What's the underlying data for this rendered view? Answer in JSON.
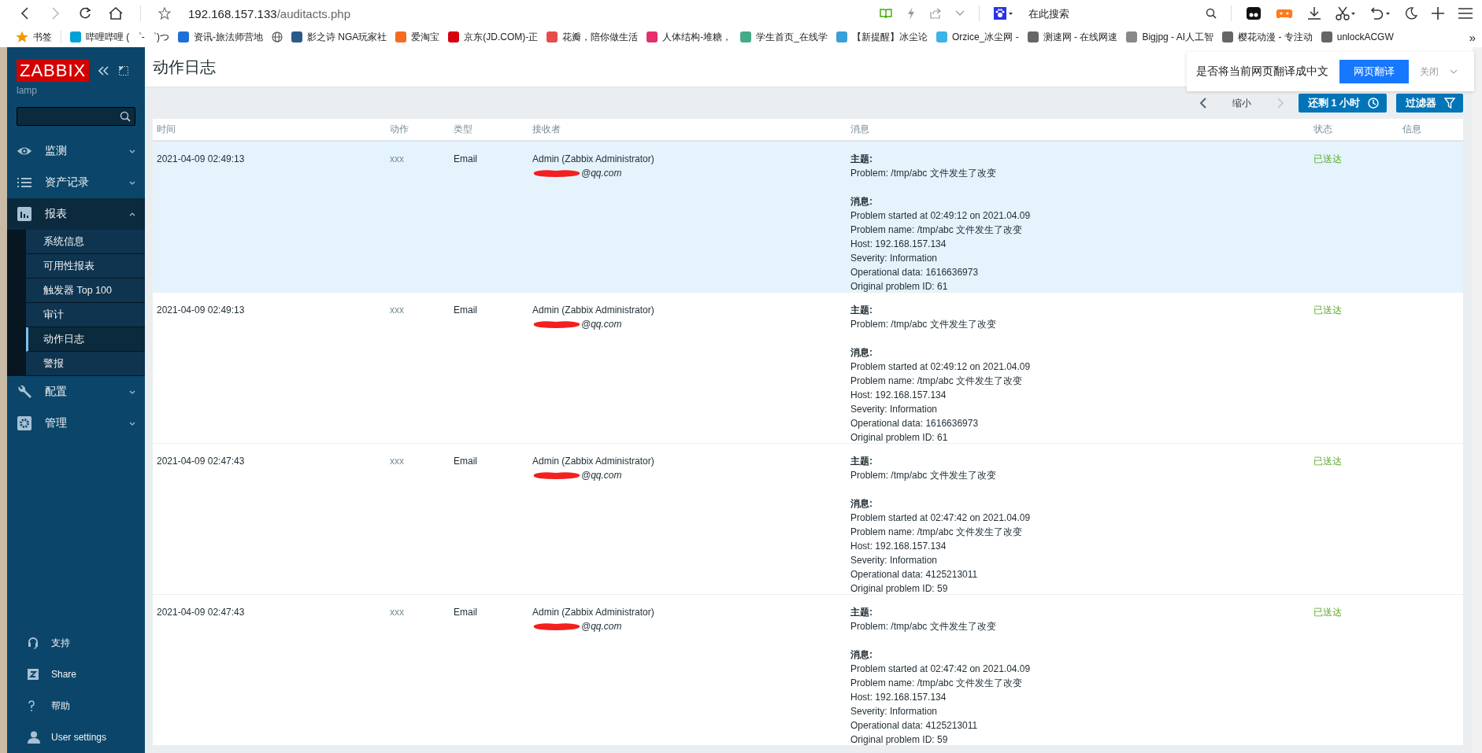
{
  "browser": {
    "url_host": "192.168.157.133",
    "url_path": "/auditacts.php",
    "search_placeholder": "在此搜索",
    "bookmarks": [
      {
        "kind": "folder",
        "label": "书签"
      },
      {
        "kind": "link",
        "label": "哔哩哔哩 ( ゜- ゜)つ"
      },
      {
        "kind": "link",
        "label": "资讯-旅法师营地"
      },
      {
        "kind": "icon-only"
      },
      {
        "kind": "link",
        "label": "影之诗 NGA玩家社"
      },
      {
        "kind": "link",
        "label": "爱淘宝"
      },
      {
        "kind": "link",
        "label": "京东(JD.COM)-正"
      },
      {
        "kind": "link",
        "label": "花瓣，陪你做生活"
      },
      {
        "kind": "link",
        "label": "人体结构-堆糖，"
      },
      {
        "kind": "link",
        "label": "学生首页_在线学"
      },
      {
        "kind": "link",
        "label": "【新提醒】冰尘论"
      },
      {
        "kind": "link",
        "label": "Orzice_冰尘网 - "
      },
      {
        "kind": "link",
        "label": "测速网 - 在线网速"
      },
      {
        "kind": "link",
        "label": "Bigjpg - AI人工智"
      },
      {
        "kind": "link",
        "label": "樱花动漫 - 专注动"
      },
      {
        "kind": "link",
        "label": "unlockACGW"
      }
    ],
    "more": "»"
  },
  "translate_bar": {
    "question": "是否将当前网页翻译成中文",
    "translate_button": "网页翻译",
    "close": "关闭"
  },
  "sidebar": {
    "logo": "ZABBIX",
    "server": "lamp",
    "menu": [
      {
        "label": "监测",
        "expanded": false
      },
      {
        "label": "资产记录",
        "expanded": false
      },
      {
        "label": "报表",
        "expanded": true,
        "children": [
          {
            "label": "系统信息",
            "selected": false
          },
          {
            "label": "可用性报表",
            "selected": false
          },
          {
            "label": "触发器 Top 100",
            "selected": false
          },
          {
            "label": "审计",
            "selected": false
          },
          {
            "label": "动作日志",
            "selected": true
          },
          {
            "label": "警报",
            "selected": false
          }
        ]
      },
      {
        "label": "配置",
        "expanded": false
      },
      {
        "label": "管理",
        "expanded": false
      }
    ],
    "footer": [
      {
        "label": "支持"
      },
      {
        "label": "Share"
      },
      {
        "label": "帮助"
      },
      {
        "label": "User settings"
      }
    ]
  },
  "page": {
    "title": "动作日志",
    "zoom_out": "缩小",
    "next_disabled": true,
    "time_button": "还剩 1 小时",
    "filter_button": "过滤器"
  },
  "table": {
    "columns": [
      "时间",
      "动作",
      "类型",
      "接收者",
      "消息",
      "状态",
      "信息"
    ],
    "rows": [
      {
        "highlighted": true,
        "time": "2021-04-09 02:49:13",
        "action": "xxx",
        "type": "Email",
        "recipient": "Admin (Zabbix Administrator)",
        "email": "@qq.com",
        "subject_label": "主题:",
        "subject": "Problem: /tmp/abc 文件发生了改变",
        "message_label": "消息:",
        "message_lines": [
          "Problem started at 02:49:12 on 2021.04.09",
          "Problem name: /tmp/abc 文件发生了改变",
          "Host: 192.168.157.134",
          "Severity: Information",
          "Operational data: 1616636973",
          "Original problem ID: 61"
        ],
        "status": "已送达"
      },
      {
        "highlighted": false,
        "time": "2021-04-09 02:49:13",
        "action": "xxx",
        "type": "Email",
        "recipient": "Admin (Zabbix Administrator)",
        "email": "@qq.com",
        "subject_label": "主题:",
        "subject": "Problem: /tmp/abc 文件发生了改变",
        "message_label": "消息:",
        "message_lines": [
          "Problem started at 02:49:12 on 2021.04.09",
          "Problem name: /tmp/abc 文件发生了改变",
          "Host: 192.168.157.134",
          "Severity: Information",
          "Operational data: 1616636973",
          "Original problem ID: 61"
        ],
        "status": "已送达"
      },
      {
        "highlighted": false,
        "time": "2021-04-09 02:47:43",
        "action": "xxx",
        "type": "Email",
        "recipient": "Admin (Zabbix Administrator)",
        "email": "@qq.com",
        "subject_label": "主题:",
        "subject": "Problem: /tmp/abc 文件发生了改变",
        "message_label": "消息:",
        "message_lines": [
          "Problem started at 02:47:42 on 2021.04.09",
          "Problem name: /tmp/abc 文件发生了改变",
          "Host: 192.168.157.134",
          "Severity: Information",
          "Operational data: 4125213011",
          "Original problem ID: 59"
        ],
        "status": "已送达"
      },
      {
        "highlighted": false,
        "time": "2021-04-09 02:47:43",
        "action": "xxx",
        "type": "Email",
        "recipient": "Admin (Zabbix Administrator)",
        "email": "@qq.com",
        "subject_label": "主题:",
        "subject": "Problem: /tmp/abc 文件发生了改变",
        "message_label": "消息:",
        "message_lines": [
          "Problem started at 02:47:42 on 2021.04.09",
          "Problem name: /tmp/abc 文件发生了改变",
          "Host: 192.168.157.134",
          "Severity: Information",
          "Operational data: 4125213011",
          "Original problem ID: 59"
        ],
        "status": "已送达"
      }
    ]
  }
}
